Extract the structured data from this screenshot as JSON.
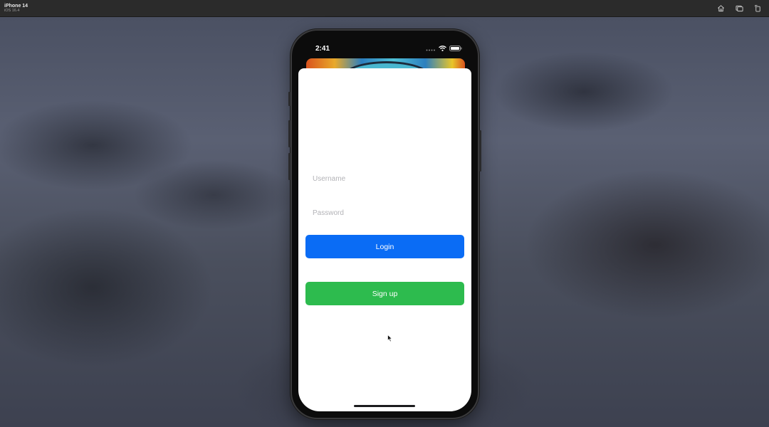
{
  "simulator": {
    "device_name": "iPhone 14",
    "os_version": "iOS 16.4",
    "toolbar": {
      "home_icon": "home-icon",
      "screenshot_icon": "screenshot-icon",
      "rotate_icon": "rotate-icon"
    }
  },
  "status_bar": {
    "time": "2:41",
    "icons": [
      "signal-icon",
      "wifi-icon",
      "battery-icon"
    ]
  },
  "login_sheet": {
    "username_placeholder": "Username",
    "username_value": "",
    "password_placeholder": "Password",
    "password_value": "",
    "login_label": "Login",
    "signup_label": "Sign up"
  },
  "colors": {
    "login_button": "#0a6cf5",
    "signup_button": "#2dbb4e",
    "sheet_background": "#ffffff",
    "titlebar": "#2b2b2b"
  }
}
